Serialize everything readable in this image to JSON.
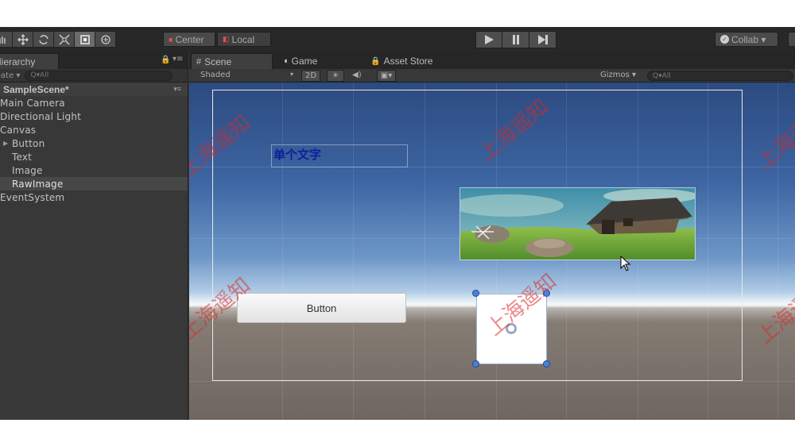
{
  "toolbar": {
    "pivot_label": "Center",
    "space_label": "Local",
    "collab_label": "Collab ▾"
  },
  "hierarchy": {
    "tab_label": "Hierarchy",
    "create_label": "Create ▾",
    "search_placeholder": "Q▾All",
    "scene_name": "SampleScene*",
    "items": [
      {
        "label": "Main Camera"
      },
      {
        "label": "Directional Light"
      },
      {
        "label": "Canvas"
      },
      {
        "label": "Button"
      },
      {
        "label": "Text"
      },
      {
        "label": "Image"
      },
      {
        "label": "RawImage"
      },
      {
        "label": "EventSystem"
      }
    ],
    "selected_item": "RawImage"
  },
  "tabs": [
    {
      "label": "Scene"
    },
    {
      "label": "Game"
    },
    {
      "label": "Asset Store"
    }
  ],
  "scene_toolbar": {
    "draw_mode": "Shaded",
    "mode_2d": "2D",
    "gizmos_label": "Gizmos ▾",
    "search_placeholder": "Q▾All"
  },
  "scene": {
    "text_content": "单个文字",
    "button_label": "Button",
    "watermark_text": "上海遥知"
  },
  "colors": {
    "selection_handle": "#4c80d8",
    "ui_text": "#0c1e9e",
    "watermark": "#dc2828"
  }
}
